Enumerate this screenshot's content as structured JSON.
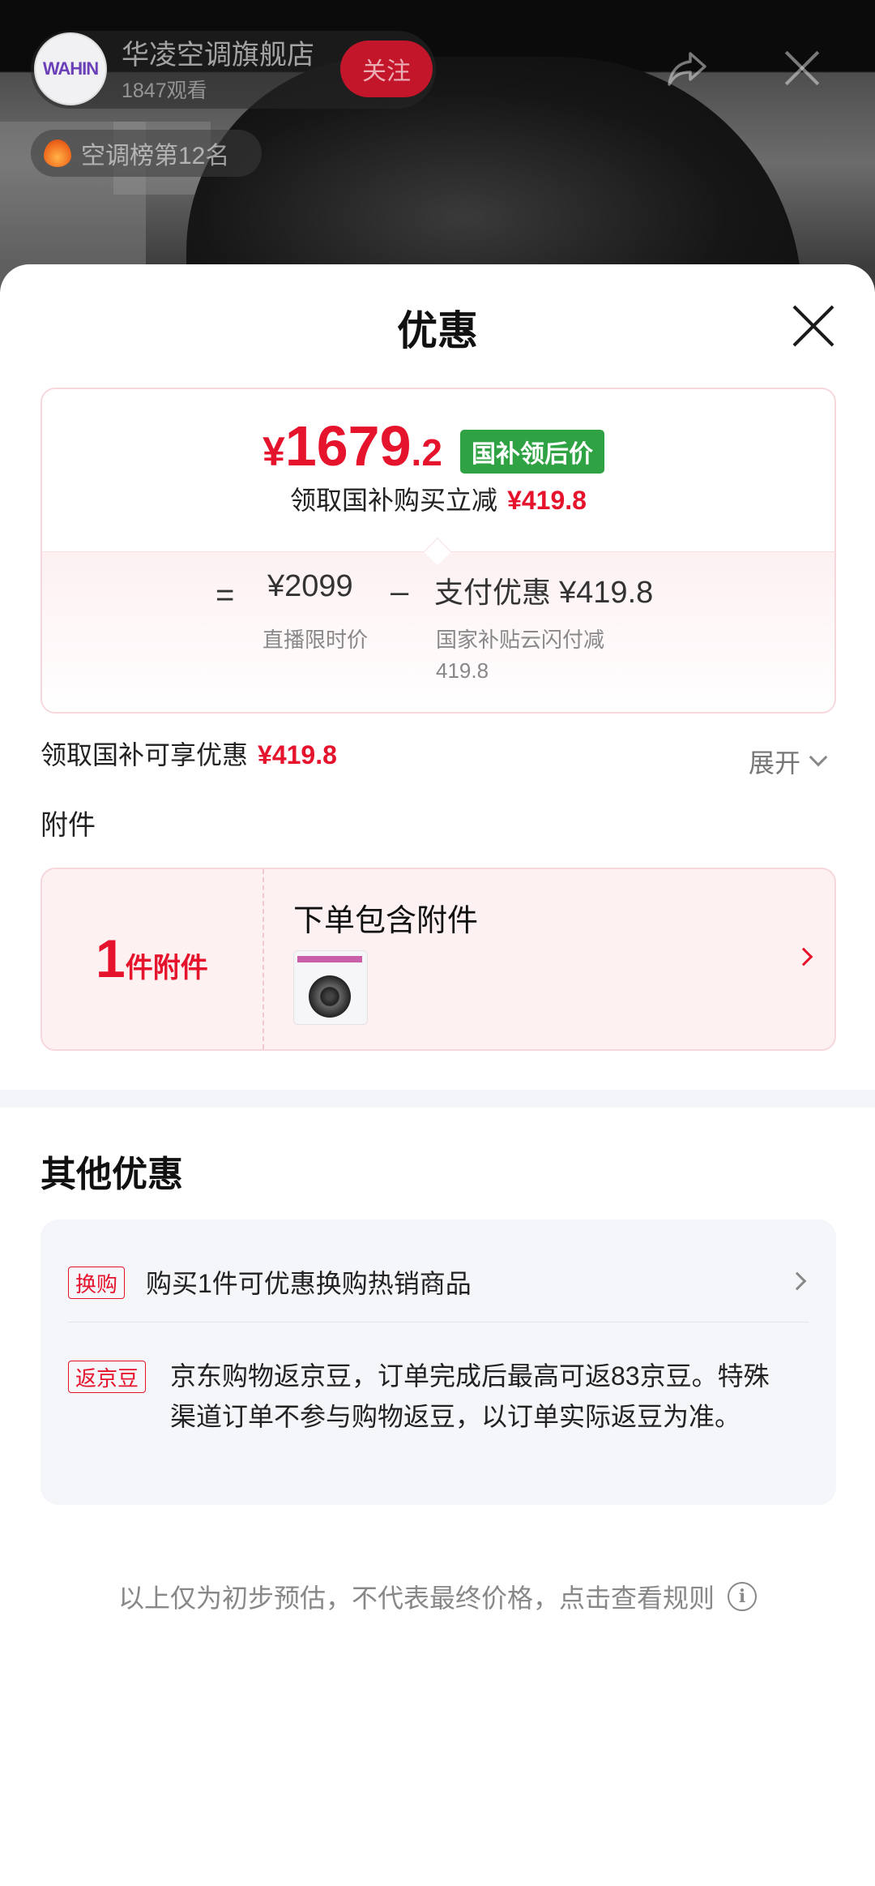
{
  "live": {
    "store_logo_text": "WAHIN",
    "store_name": "华凌空调旗舰店",
    "viewers": "1847观看",
    "follow_label": "关注",
    "rank_text": "空调榜第12名"
  },
  "sheet": {
    "title": "优惠",
    "price_card": {
      "currency": "¥",
      "price_int": "1679",
      "price_dec": ".2",
      "subsidy_tag": "国补领后价",
      "receive_text": "领取国补购买立减",
      "receive_amount": "¥419.8",
      "equals": "=",
      "original_price": "¥2099",
      "original_label": "直播限时价",
      "minus": "–",
      "pay_discount_label": "支付优惠",
      "pay_discount_amount": "¥419.8",
      "pay_detail": "国家补贴云闪付减419.8"
    },
    "enjoy": {
      "text": "领取国补可享优惠",
      "amount": "¥419.8",
      "expand_label": "展开"
    },
    "accessory": {
      "section_label": "附件",
      "count": "1",
      "count_unit": "件附件",
      "title": "下单包含附件"
    },
    "other": {
      "title": "其他优惠",
      "swap_tag": "换购",
      "swap_text": "购买1件可优惠换购热销商品",
      "bean_tag": "返京豆",
      "bean_text": "京东购物返京豆，订单完成后最高可返83京豆。特殊渠道订单不参与购物返豆，以订单实际返豆为准。"
    },
    "footer_note": "以上仅为初步预估，不代表最终价格，点击查看规则",
    "info_symbol": "i"
  },
  "colors": {
    "accent_red": "#e5132c",
    "subsidy_green": "#2fa343",
    "card_pink": "#fdf1f2"
  }
}
